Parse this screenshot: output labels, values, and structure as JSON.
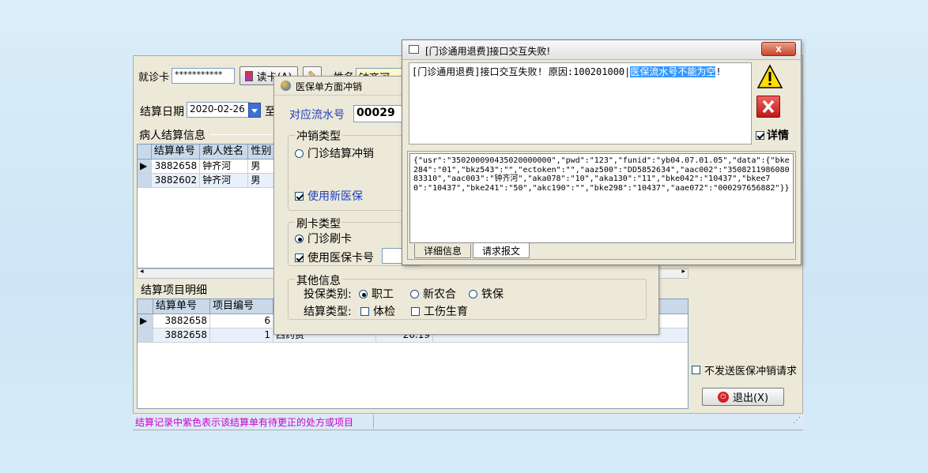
{
  "main": {
    "card_label": "就诊卡",
    "card_value": "***********",
    "read_card_label": "读卡(A)",
    "name_label": "姓名",
    "name_value": "钟齐河",
    "settle_date_label": "结算日期",
    "settle_date_value": "2020-02-26",
    "to_label": "至",
    "patient_section_title": "病人结算信息",
    "patient_columns": [
      "结算单号",
      "病人姓名",
      "性别"
    ],
    "patient_rows": [
      {
        "no": "3882658",
        "name": "钟齐河",
        "sex": "男"
      },
      {
        "no": "3882602",
        "name": "钟齐河",
        "sex": "男"
      }
    ],
    "detail_section_title": "结算项目明细",
    "detail_columns": [
      "结算单号",
      "项目编号"
    ],
    "detail_rows": [
      {
        "no": "3882658",
        "item": "6",
        "name": "",
        "amount": ""
      },
      {
        "no": "3882658",
        "item": "1",
        "name": "西药费",
        "amount": "26.19"
      }
    ],
    "no_send_label": "不发送医保冲销请求",
    "exit_label": "退出(X)",
    "status_text": "结算记录中紫色表示该结算单有待更正的处方或项目"
  },
  "dialog1": {
    "title": "医保单方面冲销",
    "serial_label": "对应流水号",
    "serial_value": "00029",
    "reversal_type_title": "冲销类型",
    "outpatient_reversal": "门诊结算冲销",
    "use_new_insurance": "使用新医保",
    "card_type_title": "刷卡类型",
    "outpatient_card": "门诊刷卡",
    "use_insurance_card_no": "使用医保卡号",
    "other_info_title": "其他信息",
    "insurance_type_label": "投保类别:",
    "insurance_types": [
      "职工",
      "新农合",
      "铁保"
    ],
    "settle_type_label": "结算类型:",
    "settle_types": [
      "体检",
      "工伤生育"
    ]
  },
  "dialog2": {
    "title": "[门诊通用退费]接口交互失败!",
    "close_label": "x",
    "message_prefix": "[门诊通用退费]接口交互失败! 原因:100201000|",
    "message_highlight": "医保流水号不能为空",
    "message_suffix": "!",
    "details_label": "详情",
    "detail_text": "{\"usr\":\"350200090435020000000\",\"pwd\":\"123\",\"funid\":\"yb04.07.01.05\",\"data\":{\"bke284\":\"01\",\"bkz543\":\"\",\"ectoken\":\"\",\"aaz500\":\"DD5852634\",\"aac002\":\"350821198608083310\",\"aac003\":\"钟齐河\",\"aka078\":\"10\",\"aka130\":\"11\",\"bke042\":\"10437\",\"bkee70\":\"10437\",\"bke241\":\"50\",\"akc190\":\"\",\"bke298\":\"10437\",\"aae072\":\"000297656882\"}}",
    "tabs": [
      "详细信息",
      "请求报文"
    ]
  },
  "colors": {
    "status_text": "#cc00cc",
    "serial_label": "#1f3fbf",
    "highlight": "#3399ff"
  }
}
